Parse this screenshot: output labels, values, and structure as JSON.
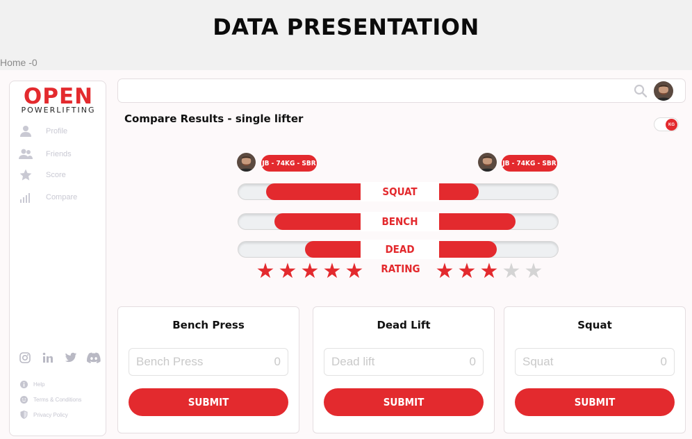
{
  "banner": {
    "title": "DATA PRESENTATION"
  },
  "frame_label": "Home -0",
  "sidebar": {
    "logo_main": "OPEN",
    "logo_sub": "POWERLIFTING",
    "nav": [
      {
        "label": "Profile",
        "icon": "user-icon"
      },
      {
        "label": "Friends",
        "icon": "friends-icon"
      },
      {
        "label": "Score",
        "icon": "star-icon"
      },
      {
        "label": "Compare",
        "icon": "bar-chart-icon"
      }
    ],
    "socials": [
      "instagram-icon",
      "linkedin-icon",
      "twitter-icon",
      "discord-icon"
    ],
    "footer": [
      {
        "label": "Help",
        "icon": "info-icon"
      },
      {
        "label": "Terms & Conditions",
        "icon": "smile-icon"
      },
      {
        "label": "Privacy Policy",
        "icon": "shield-icon"
      }
    ]
  },
  "header": {
    "search_placeholder": ""
  },
  "compare": {
    "title": "Compare Results - single lifter",
    "unit_toggle": "KG",
    "left_lifter": "JB - 74KG - SBR",
    "right_lifter": "JB - 74KG - SBR",
    "lifts": [
      {
        "label": "SQUAT",
        "left_fill": 0.77,
        "right_fill": 0.33
      },
      {
        "label": "BENCH",
        "left_fill": 0.7,
        "right_fill": 0.64
      },
      {
        "label": "DEAD",
        "left_fill": 0.45,
        "right_fill": 0.48
      }
    ],
    "rating_label": "RATING",
    "left_rating": 5,
    "right_rating": 3,
    "rating_max": 5
  },
  "cards": [
    {
      "title": "Bench Press",
      "placeholder": "Bench Press",
      "value": "0",
      "button": "SUBMIT"
    },
    {
      "title": "Dead Lift",
      "placeholder": "Dead lift",
      "value": "0",
      "button": "SUBMIT"
    },
    {
      "title": "Squat",
      "placeholder": "Squat",
      "value": "0",
      "button": "SUBMIT"
    }
  ],
  "colors": {
    "accent": "#e32a2e",
    "muted": "#c9c9d3",
    "background": "#fdf9fa"
  }
}
